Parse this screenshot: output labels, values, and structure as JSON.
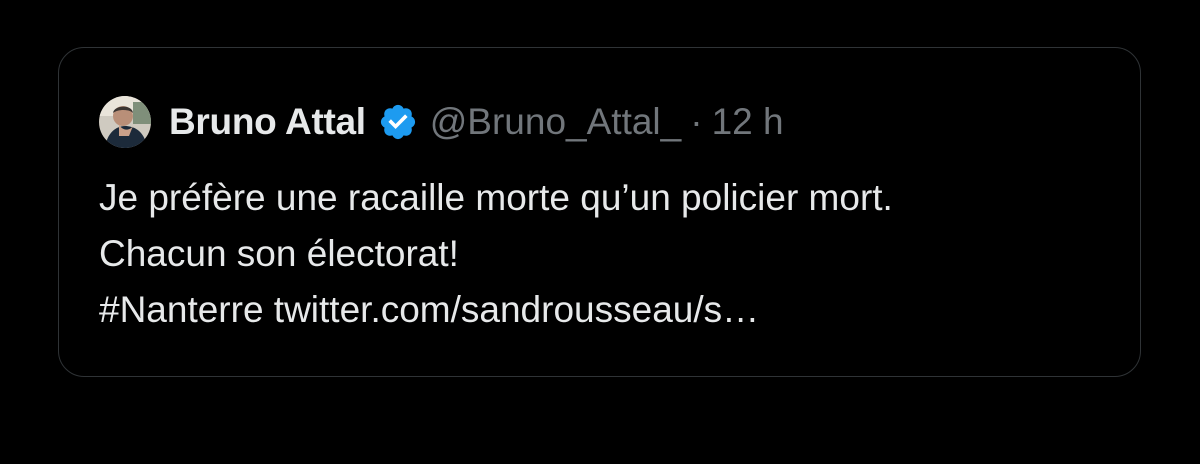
{
  "tweet": {
    "author": {
      "display_name": "Bruno Attal",
      "handle": "@Bruno_Attal_",
      "verified": true,
      "verified_icon": "verified-badge-icon",
      "avatar": "user-avatar-photo"
    },
    "separator": "·",
    "timestamp": "12 h",
    "text_lines": [
      "Je préfère une racaille morte qu’un policier mort.",
      "Chacun son électorat!",
      "#Nanterre twitter.com/sandrousseau/s…"
    ]
  },
  "colors": {
    "background": "#000000",
    "border": "#2f3336",
    "primary_text": "#e7e9ea",
    "secondary_text": "#71767b",
    "verified_blue": "#1d9bf0"
  }
}
